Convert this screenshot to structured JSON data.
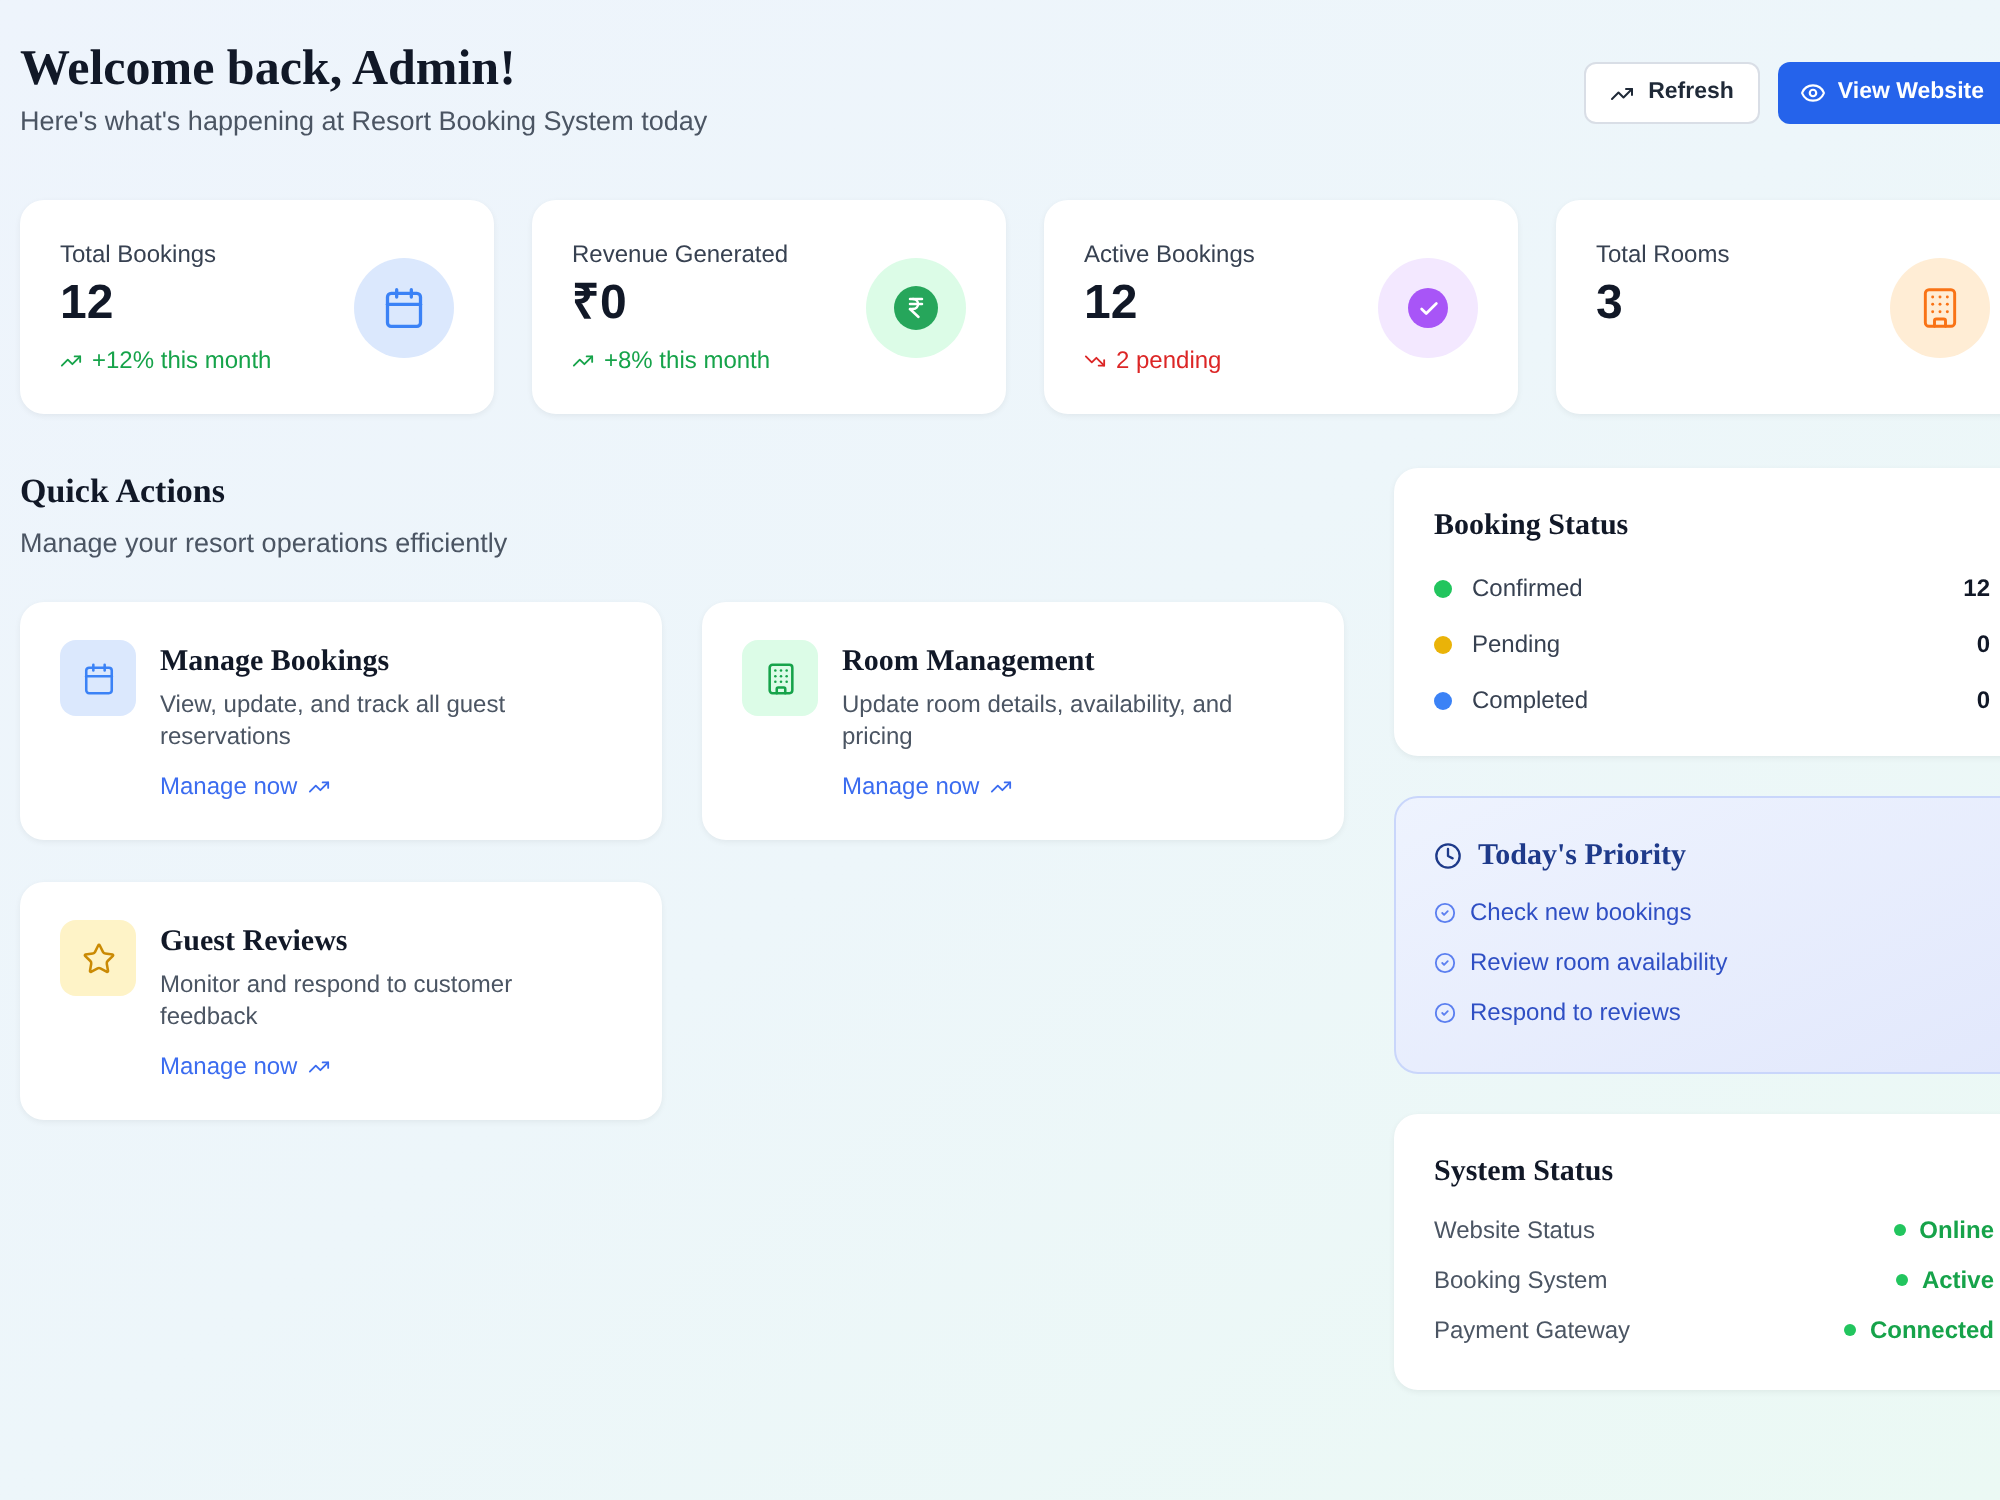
{
  "header": {
    "title": "Welcome back, Admin!",
    "subtitle": "Here's what's happening at Resort Booking System today",
    "buttons": [
      {
        "label": "Refresh",
        "kind": "refresh"
      },
      {
        "label": "View Website",
        "kind": "view"
      }
    ]
  },
  "stats": [
    {
      "kind": "bookings",
      "label": "Total Bookings",
      "value": "12",
      "change": "+12% this month",
      "falling": false
    },
    {
      "kind": "revenue",
      "label": "Revenue Generated",
      "value": "₹0",
      "change": "+8% this month",
      "falling": false
    },
    {
      "kind": "active",
      "label": "Active Bookings",
      "value": "12",
      "change": "2 pending",
      "falling": true
    },
    {
      "kind": "rooms",
      "label": "Total Rooms",
      "value": "3"
    }
  ],
  "quick_actions": {
    "title": "Quick Actions",
    "subtitle": "Manage your resort operations efficiently",
    "cards": [
      {
        "kind": "bookings",
        "title": "Manage Bookings",
        "description": "View, update, and track all guest reservations",
        "link": "Manage now"
      },
      {
        "kind": "rooms",
        "title": "Room Management",
        "description": "Update room details, availability, and pricing",
        "link": "Manage now"
      },
      {
        "kind": "reviews",
        "title": "Guest Reviews",
        "description": "Monitor and respond to customer feedback",
        "link": "Manage now"
      }
    ]
  },
  "booking_status": {
    "title": "Booking Status",
    "items": [
      {
        "label": "Confirmed",
        "count": "12",
        "color": "#22c55e"
      },
      {
        "label": "Pending",
        "count": "0",
        "color": "#eab308"
      },
      {
        "label": "Completed",
        "count": "0",
        "color": "#3b82f6"
      }
    ]
  },
  "todays_priority": {
    "title": "Today's Priority",
    "items": [
      "Check new bookings",
      "Review room availability",
      "Respond to reviews"
    ]
  },
  "system_status": {
    "title": "System Status",
    "items": [
      {
        "label": "Website Status",
        "value": "Online"
      },
      {
        "label": "Booking System",
        "value": "Active"
      },
      {
        "label": "Payment Gateway",
        "value": "Connected"
      }
    ]
  }
}
